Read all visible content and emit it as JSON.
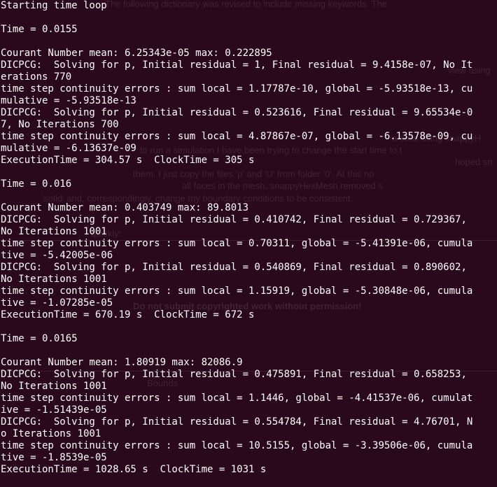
{
  "terminal": {
    "lines": [
      "Starting time loop",
      "",
      "Time = 0.0155",
      "",
      "Courant Number mean: 6.25343e-05 max: 0.222895",
      "DICPCG:  Solving for p, Initial residual = 1, Final residual = 9.4158e-07, No It",
      "erations 770",
      "time step continuity errors : sum local = 1.17787e-10, global = -5.93518e-13, cu",
      "mulative = -5.93518e-13",
      "DICPCG:  Solving for p, Initial residual = 0.523616, Final residual = 9.65534e-0",
      "7, No Iterations 700",
      "time step continuity errors : sum local = 4.87867e-07, global = -6.13578e-09, cu",
      "mulative = -6.13637e-09",
      "ExecutionTime = 304.57 s  ClockTime = 305 s",
      "",
      "Time = 0.016",
      "",
      "Courant Number mean: 0.403749 max: 89.8013",
      "DICPCG:  Solving for p, Initial residual = 0.410742, Final residual = 0.729367,",
      "No Iterations 1001",
      "time step continuity errors : sum local = 0.70311, global = -5.41391e-06, cumula",
      "tive = -5.42005e-06",
      "DICPCG:  Solving for p, Initial residual = 0.540869, Final residual = 0.890602,",
      "No Iterations 1001",
      "time step continuity errors : sum local = 1.15919, global = -5.30848e-06, cumula",
      "tive = -1.07285e-05",
      "ExecutionTime = 670.19 s  ClockTime = 672 s",
      "",
      "Time = 0.0165",
      "",
      "Courant Number mean: 1.80919 max: 82086.9",
      "DICPCG:  Solving for p, Initial residual = 0.475891, Final residual = 0.658253,",
      "No Iterations 1001",
      "time step continuity errors : sum local = 1.1446, global = -4.41537e-06, cumulat",
      "ive = -1.51439e-05",
      "DICPCG:  Solving for p, Initial residual = 0.554784, Final residual = 4.76701, N",
      "o Iterations 1001",
      "time step continuity errors : sum local = 10.5155, global = -3.39506e-06, cumula",
      "tive = -1.8539e-05",
      "ExecutionTime = 1028.65 s  ClockTime = 1031 s"
    ]
  },
  "background_page": {
    "fragments": [
      "The following dictionary was revised to include missing keywords. The ",
      "view using",
      "a solid using snappyH",
      "to run a simulation I have been trying to change the start time to t",
      "hoped sn",
      "them. I just copy the files 'p' and 'U' from folder '0'. At this no",
      "all faces in the mesh. snappyHexMesh removed s",
      "'solid' and, correspondingly, change my boundary conditions to be consistent.",
      "quickly:",
      "Do not submit copyrighted work without permission!",
      "Bounds"
    ]
  },
  "colors": {
    "background": "#2c0a1e",
    "text": "#ffffff"
  }
}
